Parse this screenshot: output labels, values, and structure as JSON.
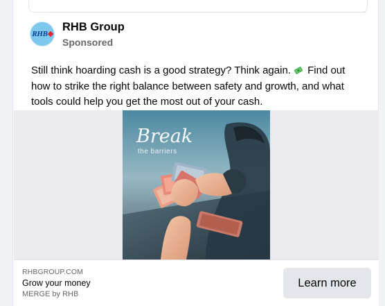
{
  "post": {
    "page_name": "RHB Group",
    "sponsored_label": "Sponsored",
    "avatar_logo": "RHB",
    "text_part1": "Still think hoarding cash is a good strategy? Think again.",
    "text_icon": "money-with-wings-icon",
    "text_part2": "Find out how to strike the right balance between safety and growth, and what tools could help you get the most out of your cash."
  },
  "image": {
    "overlay_title": "Break",
    "overlay_subtitle": "the barriers"
  },
  "cta": {
    "domain": "RHBGROUP.COM",
    "headline": "Grow your money",
    "description": "MERGE by RHB",
    "button_label": "Learn more"
  },
  "colors": {
    "background": "#f0f2f5",
    "card": "#ffffff",
    "secondary_text": "#65676b",
    "button_bg": "#e4e6eb",
    "avatar_bg": "#7ec8ee",
    "brand_blue": "#0a3d91",
    "brand_red": "#e0262e"
  }
}
